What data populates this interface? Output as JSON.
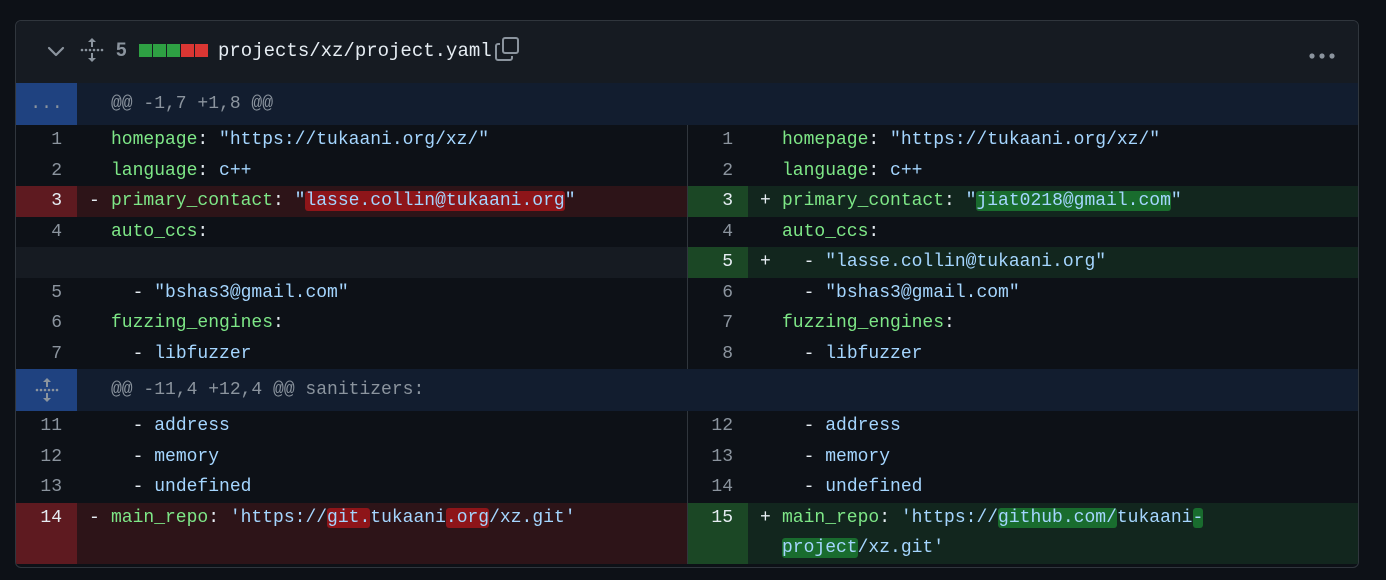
{
  "file": {
    "changes_count": "5",
    "name": "projects/xz/project.yaml",
    "diffstat": [
      {
        "type": "add",
        "color": "#2ea043"
      },
      {
        "type": "add",
        "color": "#2ea043"
      },
      {
        "type": "add",
        "color": "#2ea043"
      },
      {
        "type": "del",
        "color": "#da3633"
      },
      {
        "type": "del",
        "color": "#da3633"
      }
    ]
  },
  "icons": {
    "collapse": "chevron-down-icon",
    "move": "move-expand-icon",
    "copy": "copy-icon",
    "more": "kebab-horizontal-icon"
  },
  "colors": {
    "del_row": "#2d1418",
    "del_num": "#5e1a20",
    "add_row": "#12261e",
    "add_num": "#1b4725",
    "del_word": "#8e1519",
    "add_word": "#196c2e",
    "key": "#7ee787",
    "string": "#a5d6ff"
  },
  "hunks": [
    {
      "expander": "...",
      "header": "@@ -1,7 +1,8 @@",
      "rows": [
        {
          "left": {
            "num": "1",
            "tokens": [
              {
                "t": "homepage",
                "c": "k"
              },
              {
                "t": ": "
              },
              {
                "t": "\"https://tukaani.org/xz/\"",
                "c": "s"
              }
            ]
          },
          "right": {
            "num": "1",
            "tokens": [
              {
                "t": "homepage",
                "c": "k"
              },
              {
                "t": ": "
              },
              {
                "t": "\"https://tukaani.org/xz/\"",
                "c": "s"
              }
            ]
          }
        },
        {
          "left": {
            "num": "2",
            "tokens": [
              {
                "t": "language",
                "c": "k"
              },
              {
                "t": ": "
              },
              {
                "t": "c++",
                "c": "s"
              }
            ]
          },
          "right": {
            "num": "2",
            "tokens": [
              {
                "t": "language",
                "c": "k"
              },
              {
                "t": ": "
              },
              {
                "t": "c++",
                "c": "s"
              }
            ]
          }
        },
        {
          "left": {
            "num": "3",
            "type": "del",
            "marker": "-",
            "tokens": [
              {
                "t": "primary_contact",
                "c": "k"
              },
              {
                "t": ": "
              },
              {
                "t": "\"",
                "c": "s"
              },
              {
                "t": "lasse.collin@tukaani.org",
                "c": "s",
                "h": 1
              },
              {
                "t": "\"",
                "c": "s"
              }
            ]
          },
          "right": {
            "num": "3",
            "type": "add",
            "marker": "+",
            "tokens": [
              {
                "t": "primary_contact",
                "c": "k"
              },
              {
                "t": ": "
              },
              {
                "t": "\"",
                "c": "s"
              },
              {
                "t": "jiat0218@gmail.com",
                "c": "s",
                "h": 1
              },
              {
                "t": "\"",
                "c": "s"
              }
            ]
          }
        },
        {
          "left": {
            "num": "4",
            "tokens": [
              {
                "t": "auto_ccs",
                "c": "k"
              },
              {
                "t": ":"
              }
            ]
          },
          "right": {
            "num": "4",
            "tokens": [
              {
                "t": "auto_ccs",
                "c": "k"
              },
              {
                "t": ":"
              }
            ]
          }
        },
        {
          "left": {
            "type": "empty"
          },
          "right": {
            "num": "5",
            "type": "add",
            "marker": "+",
            "tokens": [
              {
                "t": "  - "
              },
              {
                "t": "\"lasse.collin@tukaani.org\"",
                "c": "s"
              }
            ]
          }
        },
        {
          "left": {
            "num": "5",
            "tokens": [
              {
                "t": "  - "
              },
              {
                "t": "\"bshas3@gmail.com\"",
                "c": "s"
              }
            ]
          },
          "right": {
            "num": "6",
            "tokens": [
              {
                "t": "  - "
              },
              {
                "t": "\"bshas3@gmail.com\"",
                "c": "s"
              }
            ]
          }
        },
        {
          "left": {
            "num": "6",
            "tokens": [
              {
                "t": "fuzzing_engines",
                "c": "k"
              },
              {
                "t": ":"
              }
            ]
          },
          "right": {
            "num": "7",
            "tokens": [
              {
                "t": "fuzzing_engines",
                "c": "k"
              },
              {
                "t": ":"
              }
            ]
          }
        },
        {
          "left": {
            "num": "7",
            "tokens": [
              {
                "t": "  - "
              },
              {
                "t": "libfuzzer",
                "c": "s"
              }
            ]
          },
          "right": {
            "num": "8",
            "tokens": [
              {
                "t": "  - "
              },
              {
                "t": "libfuzzer",
                "c": "s"
              }
            ]
          }
        }
      ]
    },
    {
      "expander_icon": "expand-icon",
      "header": "@@ -11,4 +12,4 @@ sanitizers:",
      "rows": [
        {
          "left": {
            "num": "11",
            "tokens": [
              {
                "t": "  - "
              },
              {
                "t": "address",
                "c": "s"
              }
            ]
          },
          "right": {
            "num": "12",
            "tokens": [
              {
                "t": "  - "
              },
              {
                "t": "address",
                "c": "s"
              }
            ]
          }
        },
        {
          "left": {
            "num": "12",
            "tokens": [
              {
                "t": "  - "
              },
              {
                "t": "memory",
                "c": "s"
              }
            ]
          },
          "right": {
            "num": "13",
            "tokens": [
              {
                "t": "  - "
              },
              {
                "t": "memory",
                "c": "s"
              }
            ]
          }
        },
        {
          "left": {
            "num": "13",
            "tokens": [
              {
                "t": "  - "
              },
              {
                "t": "undefined",
                "c": "s"
              }
            ]
          },
          "right": {
            "num": "14",
            "tokens": [
              {
                "t": "  - "
              },
              {
                "t": "undefined",
                "c": "s"
              }
            ]
          }
        },
        {
          "left": {
            "num": "14",
            "type": "del",
            "marker": "-",
            "tokens": [
              {
                "t": "main_repo",
                "c": "k"
              },
              {
                "t": ": "
              },
              {
                "t": "'https://",
                "c": "s"
              },
              {
                "t": "git.",
                "c": "s",
                "h": 1
              },
              {
                "t": "tukaani",
                "c": "s"
              },
              {
                "t": ".org",
                "c": "s",
                "h": 1
              },
              {
                "t": "/xz.git'",
                "c": "s"
              }
            ]
          },
          "right": {
            "num": "15",
            "type": "add",
            "marker": "+",
            "tokens": [
              {
                "t": "main_repo",
                "c": "k"
              },
              {
                "t": ": "
              },
              {
                "t": "'https://",
                "c": "s"
              },
              {
                "t": "github.com/",
                "c": "s",
                "h": 1
              },
              {
                "t": "tukaani",
                "c": "s"
              },
              {
                "t": "-",
                "c": "s",
                "h": 1
              }
            ],
            "tokens2": [
              {
                "t": "project",
                "c": "s",
                "h": 1
              },
              {
                "t": "/xz.git'",
                "c": "s"
              }
            ]
          }
        }
      ]
    }
  ]
}
